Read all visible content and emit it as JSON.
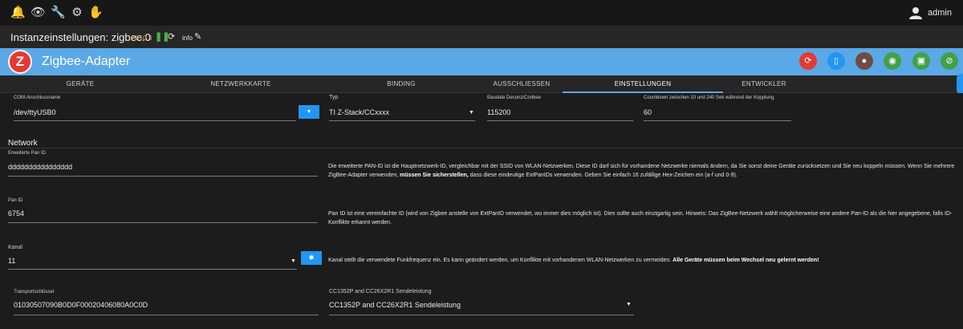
{
  "topbar": {
    "icons": [
      "bell-icon",
      "eye-icon",
      "wrench-icon",
      "settings-icon",
      "hand-icon"
    ],
    "user": "admin"
  },
  "instance": {
    "title": "Instanzeinstellungen: zigbee.0",
    "version": "v1.10.3",
    "info": "info"
  },
  "header": {
    "logo": "Z",
    "title": "Zigbee-Adapter",
    "accent": "#5ba8e6",
    "buttons": [
      {
        "name": "restart-button",
        "color": "#e53935",
        "glyph": "⟳"
      },
      {
        "name": "device-button",
        "color": "#2196f3",
        "glyph": "▯"
      },
      {
        "name": "cookie-button",
        "color": "#6d4c41",
        "glyph": "●"
      },
      {
        "name": "wifi-button",
        "color": "#43a047",
        "glyph": "◉"
      },
      {
        "name": "chip-button",
        "color": "#43a047",
        "glyph": "▣"
      },
      {
        "name": "wifi-off-button",
        "color": "#43a047",
        "glyph": "⊘"
      }
    ]
  },
  "tabs": [
    {
      "label": "GERÄTE"
    },
    {
      "label": "NETZWERKKARTE"
    },
    {
      "label": "BINDING"
    },
    {
      "label": "AUSSCHLIESSEN"
    },
    {
      "label": "EINSTELLUNGEN",
      "active": true
    },
    {
      "label": "ENTWICKLER"
    }
  ],
  "form": {
    "com_label": "COM-Anschlussname",
    "com_value": "/dev/ttyUSB0",
    "type_label": "Typ",
    "type_value": "TI Z-Stack/CCxxxx",
    "baud_label": "Baudate Deconz/Conbee",
    "baud_value": "115200",
    "countdown_label": "Countdown zwischen 10 und 240 Sek während der Kopplung",
    "countdown_value": "60",
    "network_title": "Network",
    "extpan_label": "Erweiterte Pan ID",
    "extpan_value": "dddddddddddddddd",
    "extpan_desc_1": "Die erweiterte PAN-ID ist die Hauptnetzwerk-ID, vergleichbar mit der SSID von WLAN-Netzwerken. Diese ID darf sich für vorhandene Netzwerke niemals ändern, da Sie sonst deine Geräte zurücksetzen und Sie neu koppeln müssen. Wenn Sie mehrere ZigBee-Adapter verwenden, ",
    "extpan_desc_bold": "müssen Sie sicherstellen,",
    "extpan_desc_2": " dass diese eindeutige ExtPanIDs verwenden. Geben Sie einfach 16 zufällige Hex-Zeichen ein (a-f und 0-9).",
    "panid_label": "Pan ID",
    "panid_value": "6754",
    "panid_desc": "Pan ID ist eine vereinfachte ID (wird von Zigbee anstelle von ExtPanID verwendet, wo immer dies möglich ist). Dies sollte auch einzigartig sein. Hinweis: Das ZigBee-Netzwerk wählt möglicherweise eine andere Pan-ID als die hier angegebene, falls ID-Konflikte erkannt werden.",
    "channel_label": "Kanal",
    "channel_value": "11",
    "channel_desc_1": "Kanal stellt die verwendete Funkfrequenz ein. Es kann geändert werden, um Konflikte mit vorhandenen WLAN-Netzwerken zu vermeiden. ",
    "channel_desc_bold": "Alle Geräte müssen beim Wechsel neu gelernt werden!",
    "transport_label": "Transportschlüssel",
    "transport_value": "01030507090B0D0F00020406080A0C0D",
    "power_label": "CC1352P and CC26X2R1 Sendeleistung",
    "power_value": "CC1352P and CC26X2R1 Sendeleistung"
  }
}
